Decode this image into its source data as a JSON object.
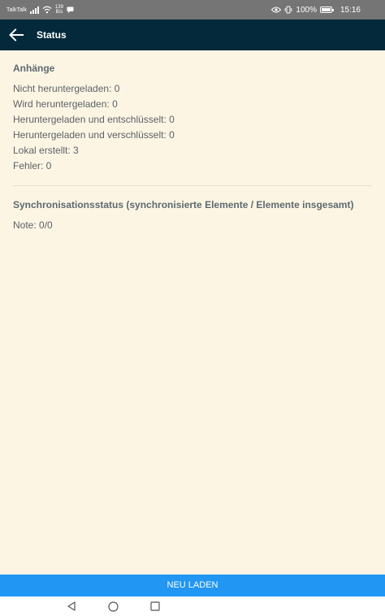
{
  "status_bar": {
    "carrier": "TalkTalk",
    "speed_value": "139",
    "speed_unit": "B/s",
    "battery_percent": "100%",
    "time": "15:16"
  },
  "app_bar": {
    "title": "Status",
    "back_icon": "arrow-left-icon"
  },
  "attachments": {
    "heading": "Anhänge",
    "rows": [
      "Nicht heruntergeladen: 0",
      "Wird heruntergeladen: 0",
      "Heruntergeladen und entschlüsselt: 0",
      "Heruntergeladen und verschlüsselt: 0",
      "Lokal erstellt: 3",
      "Fehler: 0"
    ]
  },
  "sync": {
    "heading": "Synchronisationsstatus (synchronisierte Elemente / Elemente insgesamt)",
    "rows": [
      "Note: 0/0"
    ]
  },
  "reload_button": {
    "label": "NEU LADEN"
  },
  "nav_bar": {
    "icons": [
      "back-triangle-icon",
      "home-circle-icon",
      "recents-square-icon"
    ]
  },
  "colors": {
    "status_bar": "#757575",
    "app_bar": "#04293a",
    "content_background": "#fcf5e3",
    "text": "#5b6268",
    "button": "#2196f3"
  }
}
